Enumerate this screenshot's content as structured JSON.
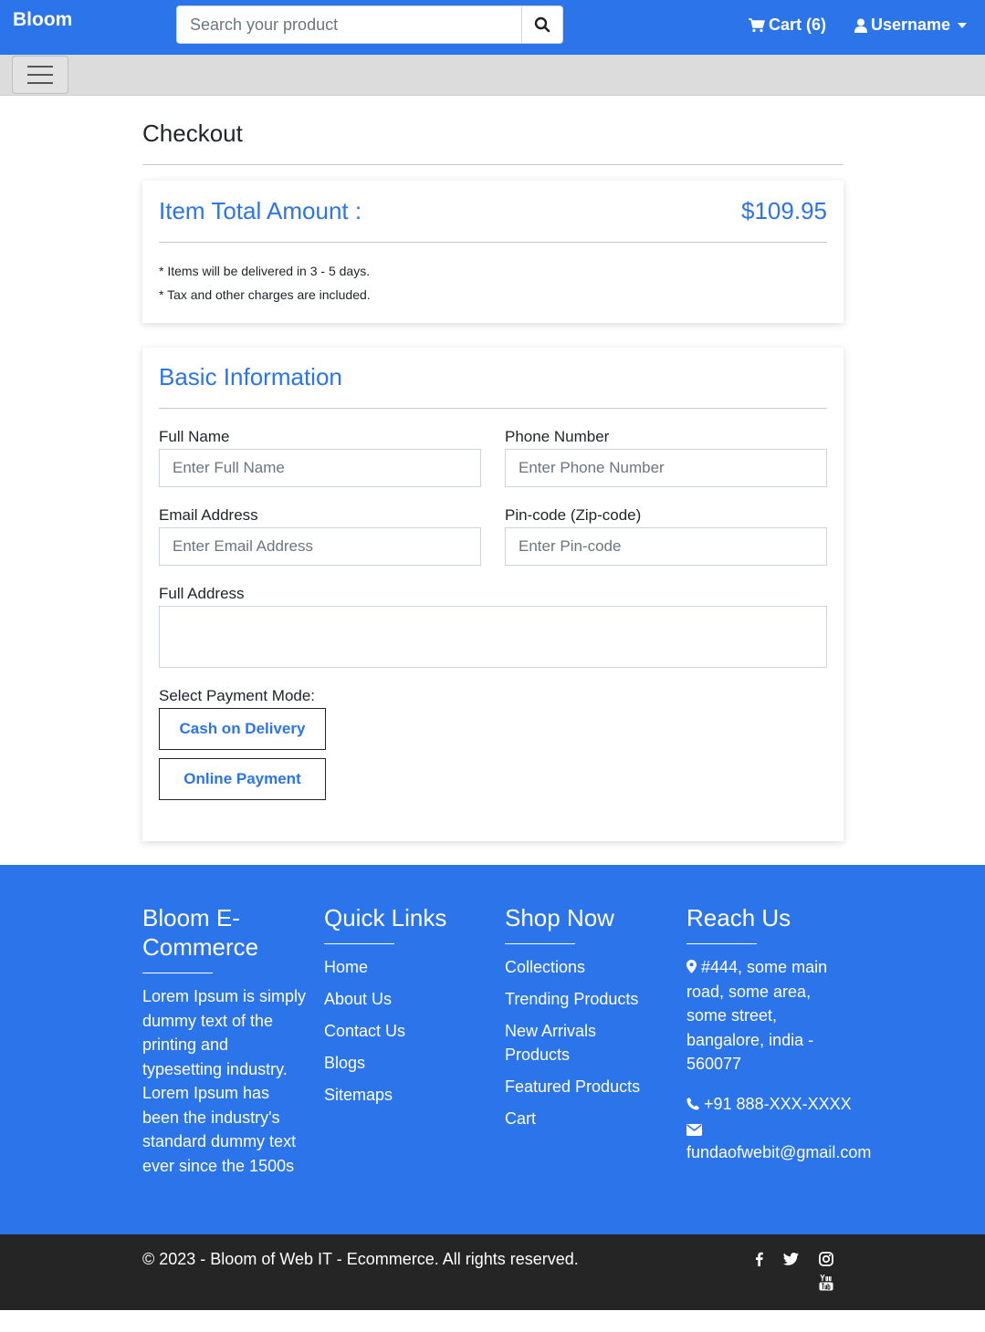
{
  "header": {
    "brand": "Bloom",
    "search_placeholder": "Search your product",
    "cart_label": "Cart (6)",
    "user_label": "Username"
  },
  "checkout": {
    "title": "Checkout",
    "total_label": "Item Total Amount :",
    "total_amount": "$109.95",
    "notes": [
      "* Items will be delivered in 3 - 5 days.",
      "* Tax and other charges are included."
    ]
  },
  "basic_info": {
    "title": "Basic Information",
    "full_name_label": "Full Name",
    "full_name_placeholder": "Enter Full Name",
    "phone_label": "Phone Number",
    "phone_placeholder": "Enter Phone Number",
    "email_label": "Email Address",
    "email_placeholder": "Enter Email Address",
    "pincode_label": "Pin-code (Zip-code)",
    "pincode_placeholder": "Enter Pin-code",
    "address_label": "Full Address",
    "payment_label": "Select Payment Mode:",
    "cod_button": "Cash on Delivery",
    "online_button": "Online Payment"
  },
  "footer": {
    "about": {
      "title": "Bloom E-Commerce",
      "text": "Lorem Ipsum is simply dummy text of the printing and typesetting industry. Lorem Ipsum has been the industry's standard dummy text ever since the 1500s"
    },
    "quick_links": {
      "title": "Quick Links",
      "items": [
        "Home",
        "About Us",
        "Contact Us",
        "Blogs",
        "Sitemaps"
      ]
    },
    "shop_now": {
      "title": "Shop Now",
      "items": [
        "Collections",
        "Trending Products",
        "New Arrivals Products",
        "Featured Products",
        "Cart"
      ]
    },
    "reach_us": {
      "title": "Reach Us",
      "address": "#444, some main road, some area, some street, bangalore, india - 560077",
      "phone": "+91 888-XXX-XXXX",
      "email": "fundaofwebit@gmail.com"
    },
    "copyright": "© 2023 - Bloom of Web IT - Ecommerce. All rights reserved."
  },
  "icons": {
    "search": "search-icon",
    "cart": "cart-icon",
    "user": "user-icon",
    "menu": "hamburger-icon",
    "location": "map-marker-icon",
    "phone": "phone-icon",
    "email": "envelope-icon",
    "social": [
      "facebook-icon",
      "twitter-icon",
      "instagram-icon",
      "youtube-icon"
    ]
  },
  "colors": {
    "primary": "#2b74ea",
    "dark_bar": "#252525",
    "subbar": "#dcdcdc"
  }
}
